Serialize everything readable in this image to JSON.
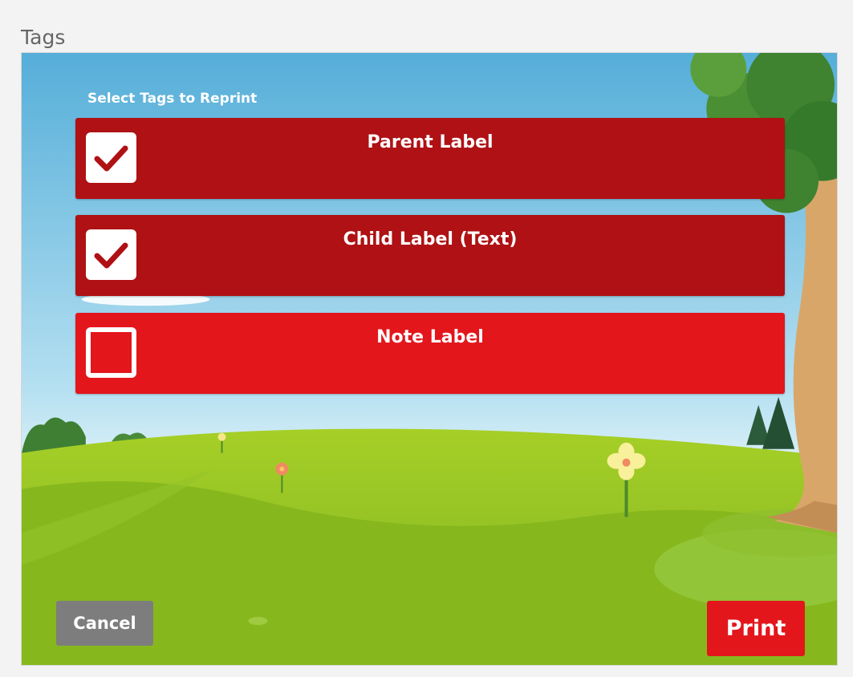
{
  "page": {
    "title": "Tags"
  },
  "reprint": {
    "section_title": "Select Tags to Reprint",
    "tags": [
      {
        "label": "Parent Label",
        "checked": true
      },
      {
        "label": "Child Label (Text)",
        "checked": true
      },
      {
        "label": "Note Label",
        "checked": false
      }
    ]
  },
  "actions": {
    "cancel_label": "Cancel",
    "print_label": "Print"
  },
  "colors": {
    "selected_row": "#af1114",
    "unselected_row": "#e3161c",
    "cancel_button": "#7d7d7d",
    "print_button": "#e3161c",
    "sky": "#7cc3e4",
    "grass": "#88bb1f"
  }
}
